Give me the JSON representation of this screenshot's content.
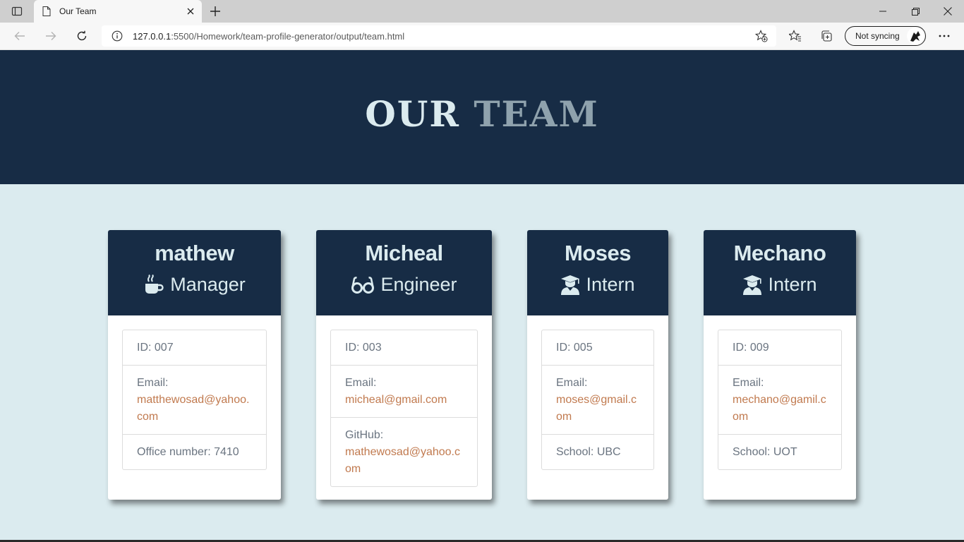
{
  "browser": {
    "tab_title": "Our Team",
    "url_host": "127.0.0.1",
    "url_rest": ":5500/Homework/team-profile-generator/output/team.html",
    "sync_label": "Not syncing"
  },
  "header": {
    "title_word1": "OUR",
    "title_word2": "TEAM"
  },
  "team": [
    {
      "name": "mathew",
      "role": "Manager",
      "role_icon": "coffee-icon",
      "id": "ID: 007",
      "email_label": "Email:",
      "email": "matthewosad@yahoo.com",
      "extra_label": "Office number: 7410",
      "extra_value": ""
    },
    {
      "name": "Micheal",
      "role": "Engineer",
      "role_icon": "glasses-icon",
      "id": "ID: 003",
      "email_label": "Email:",
      "email": "micheal@gmail.com",
      "extra_label": "GitHub:",
      "extra_value": "mathewosad@yahoo.com"
    },
    {
      "name": "Moses",
      "role": "Intern",
      "role_icon": "graduate-icon",
      "id": "ID: 005",
      "email_label": "Email:",
      "email": "moses@gmail.com",
      "extra_label": "School: UBC",
      "extra_value": ""
    },
    {
      "name": "Mechano",
      "role": "Intern",
      "role_icon": "graduate-icon",
      "id": "ID: 009",
      "email_label": "Email:",
      "email": "mechano@gamil.com",
      "extra_label": "School: UOT",
      "extra_value": ""
    }
  ],
  "colors": {
    "header_bg": "#172c45",
    "page_bg": "#dbebef",
    "link": "#c17a4f",
    "title_light": "#dbebef",
    "title_muted": "#8fa2ad"
  }
}
